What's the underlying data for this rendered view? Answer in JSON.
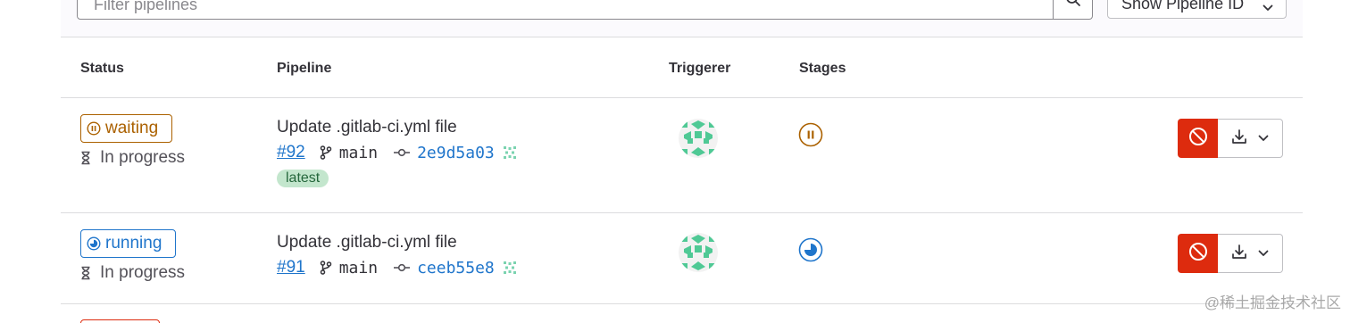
{
  "filter": {
    "placeholder": "Filter pipelines",
    "show_id_label": "Show Pipeline ID"
  },
  "columns": {
    "status": "Status",
    "pipeline": "Pipeline",
    "triggerer": "Triggerer",
    "stages": "Stages"
  },
  "colors": {
    "waiting": "#ab6100",
    "running": "#1f75cb",
    "cancel": "#dd2b0e",
    "link": "#1f75cb"
  },
  "rows": [
    {
      "status_label": "waiting",
      "status_icon": "pause-icon",
      "progress": "In progress",
      "title": "Update .gitlab-ci.yml file",
      "pipeline_id": "#92",
      "branch": "main",
      "commit_sha": "2e9d5a03",
      "tag": "latest",
      "stage_icon": "pause-icon"
    },
    {
      "status_label": "running",
      "status_icon": "running-icon",
      "progress": "In progress",
      "title": "Update .gitlab-ci.yml file",
      "pipeline_id": "#91",
      "branch": "main",
      "commit_sha": "ceeb55e8",
      "stage_icon": "running-icon"
    }
  ],
  "watermark": "@稀土掘金技术社区"
}
